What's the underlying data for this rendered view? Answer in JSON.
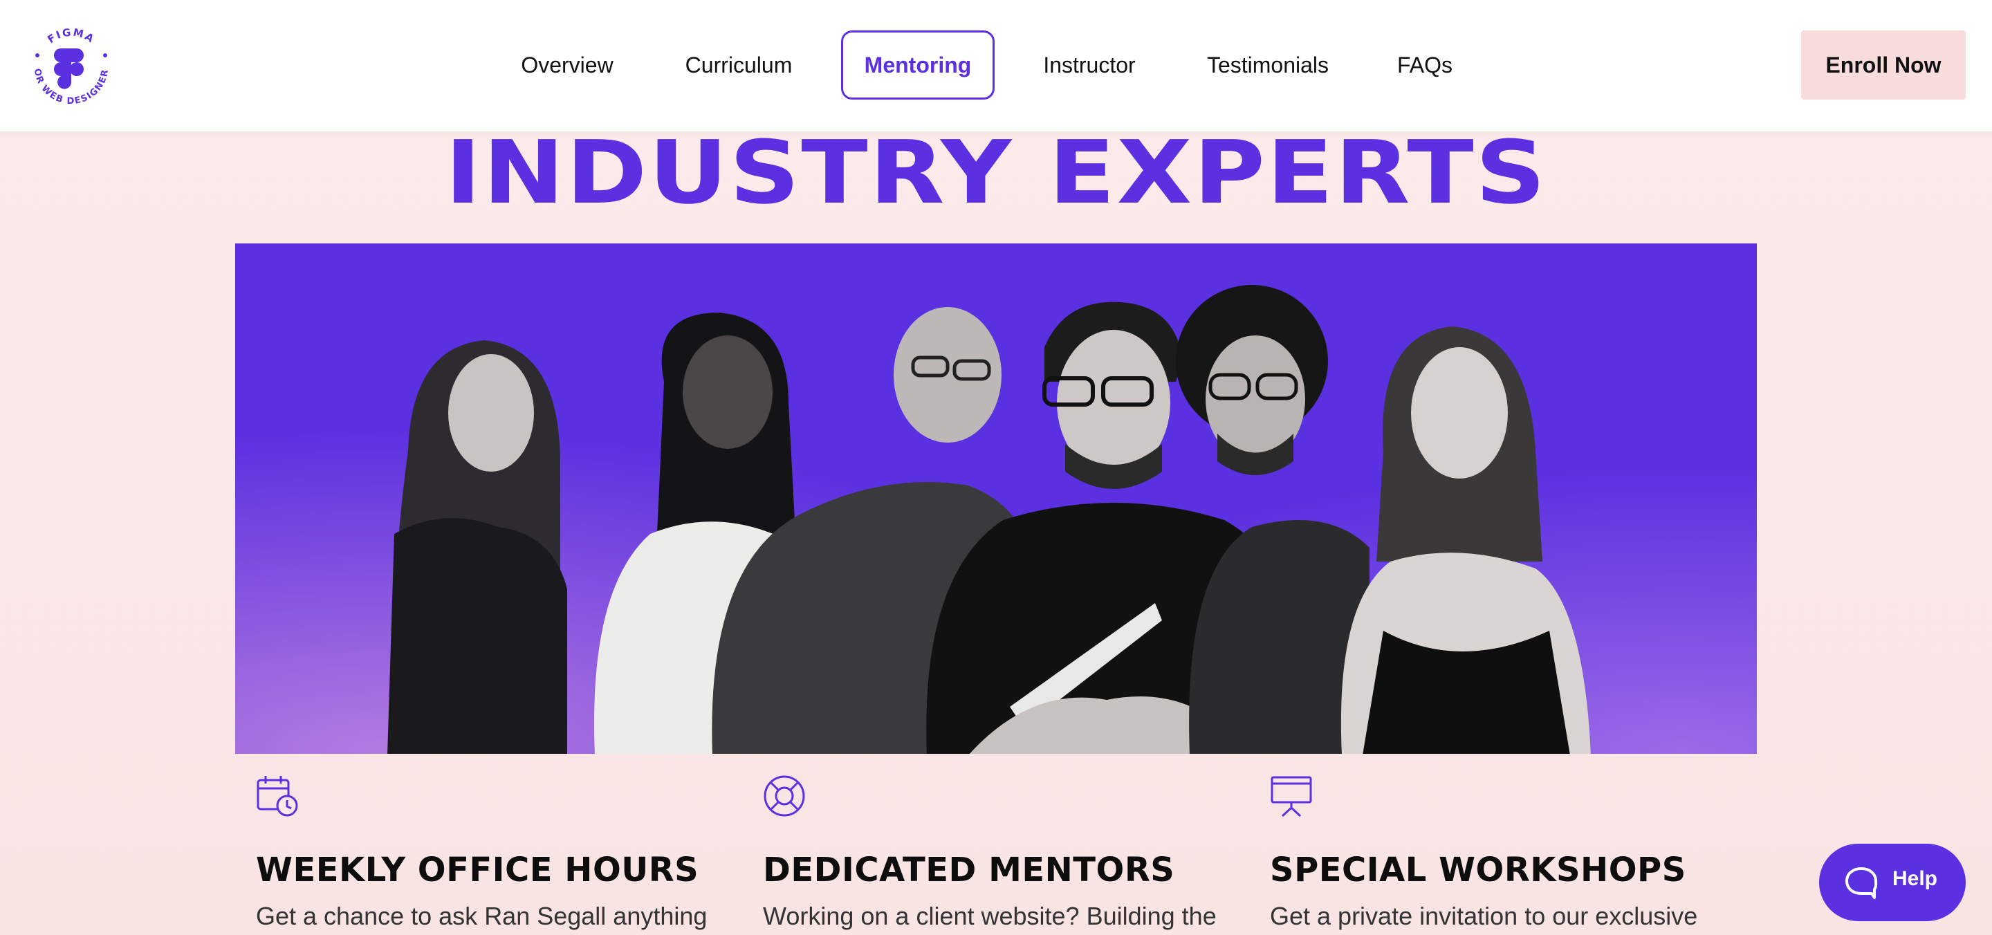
{
  "brand": {
    "badge_top": "FIGMA",
    "badge_bottom": "FOR WEB DESIGNERS",
    "accent_color": "#5b30e0"
  },
  "nav": {
    "items": [
      {
        "label": "Overview"
      },
      {
        "label": "Curriculum"
      },
      {
        "label": "Mentoring",
        "active": true
      },
      {
        "label": "Instructor"
      },
      {
        "label": "Testimonials"
      },
      {
        "label": "FAQs"
      }
    ],
    "enroll_label": "Enroll Now"
  },
  "hero": {
    "heading": "INDUSTRY EXPERTS",
    "image_description_icon": "group-photo"
  },
  "features": [
    {
      "icon": "calendar-clock-icon",
      "title": "WEEKLY OFFICE HOURS",
      "text": "Get a chance to ask Ran Segall anything"
    },
    {
      "icon": "lifebuoy-icon",
      "title": "DEDICATED MENTORS",
      "text": "Working on a client website? Building the"
    },
    {
      "icon": "presentation-board-icon",
      "title": "SPECIAL WORKSHOPS",
      "text": "Get a private invitation to our exclusive"
    }
  ],
  "help": {
    "label": "Help",
    "icon": "chat-bubble-icon"
  }
}
